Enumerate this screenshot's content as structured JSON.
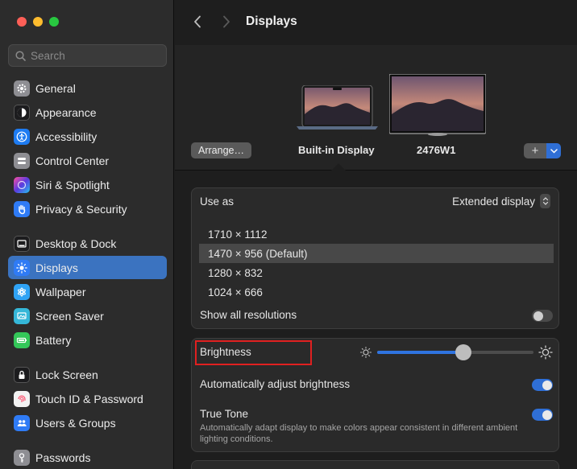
{
  "search": {
    "placeholder": "Search"
  },
  "colors": {
    "accent": "#2f6fd6",
    "selection": "#3b73c0",
    "highlight_box": "#e02020"
  },
  "sidebar": {
    "items": [
      {
        "label": "General",
        "icon": "gear-icon",
        "color": "#8e8e93"
      },
      {
        "label": "Appearance",
        "icon": "appearance-icon",
        "color": "#1c1c1e"
      },
      {
        "label": "Accessibility",
        "icon": "accessibility-icon",
        "color": "#1e7cf2"
      },
      {
        "label": "Control Center",
        "icon": "control-center-icon",
        "color": "#8e8e93"
      },
      {
        "label": "Siri & Spotlight",
        "icon": "siri-icon",
        "color": "#6b3fd1"
      },
      {
        "label": "Privacy & Security",
        "icon": "hand-icon",
        "color": "#2f7bf5"
      },
      {
        "label": "Desktop & Dock",
        "icon": "dock-icon",
        "color": "#1c1c1e"
      },
      {
        "label": "Displays",
        "icon": "sun-icon",
        "color": "#2f7bf5",
        "active": true
      },
      {
        "label": "Wallpaper",
        "icon": "flower-icon",
        "color": "#2fa3f5"
      },
      {
        "label": "Screen Saver",
        "icon": "screen-saver-icon",
        "color": "#35b7d8"
      },
      {
        "label": "Battery",
        "icon": "battery-icon",
        "color": "#34c759"
      },
      {
        "label": "Lock Screen",
        "icon": "lock-icon",
        "color": "#1c1c1e"
      },
      {
        "label": "Touch ID & Password",
        "icon": "fingerprint-icon",
        "color": "#f2f2f2"
      },
      {
        "label": "Users & Groups",
        "icon": "users-icon",
        "color": "#2f7bf5"
      },
      {
        "label": "Passwords",
        "icon": "key-icon",
        "color": "#8e8e93"
      }
    ]
  },
  "header": {
    "title": "Displays"
  },
  "displays": {
    "arrange_label": "Arrange…",
    "builtin_label": "Built-in Display",
    "external_label": "2476W1",
    "add_label": "+"
  },
  "settings": {
    "use_as_label": "Use as",
    "use_as_value": "Extended display",
    "resolutions": [
      "1710 × 1112",
      "1470 × 956 (Default)",
      "1280 × 832",
      "1024 × 666"
    ],
    "selected_resolution_index": 1,
    "show_all_label": "Show all resolutions",
    "show_all_on": false,
    "brightness_label": "Brightness",
    "brightness_value": 0.55,
    "auto_brightness_label": "Automatically adjust brightness",
    "auto_brightness_on": true,
    "true_tone_label": "True Tone",
    "true_tone_desc": "Automatically adapt display to make colors appear consistent in different ambient lighting conditions.",
    "true_tone_on": true
  }
}
